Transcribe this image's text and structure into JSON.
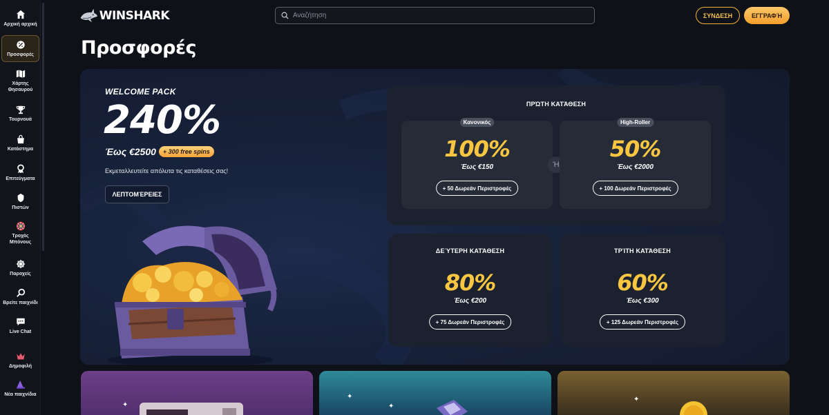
{
  "sidebar": {
    "items": [
      {
        "label": "Αρχική αρχική",
        "icon": "home-icon"
      },
      {
        "label": "Προσφορές",
        "icon": "promo-icon",
        "active": true
      },
      {
        "label": "Χάρτης Θησαυρού",
        "icon": "map-icon"
      },
      {
        "label": "Τουρνουά",
        "icon": "trophy-icon"
      },
      {
        "label": "Κατάστημα",
        "icon": "bag-icon"
      },
      {
        "label": "Επιτεύγματα",
        "icon": "achievement-icon"
      },
      {
        "label": "Πιστών",
        "icon": "loyalty-icon"
      },
      {
        "label": "Τροχός Μπόνους",
        "icon": "wheel-icon"
      },
      {
        "label": "Παροχείς",
        "icon": "providers-icon"
      },
      {
        "label": "Βρείτε παιχνίδι",
        "icon": "search-icon"
      },
      {
        "label": "Live Chat",
        "icon": "chat-icon"
      },
      {
        "label": "Δημοφιλή",
        "icon": "crown-icon"
      },
      {
        "label": "Νέα παιχνίδια",
        "icon": "wizard-hat-icon"
      }
    ]
  },
  "header": {
    "logo": "WINSHARK",
    "search_placeholder": "Αναζήτηση",
    "login_label": "ΣΥΝΔΕΣΗ",
    "register_label": "ΕΓΓΡΑΦΉ"
  },
  "page": {
    "title": "Προσφορές"
  },
  "hero": {
    "kicker": "WELCOME PACK",
    "percent": "240%",
    "upto": "Έως €2500",
    "spins_badge": "+ 300 free spins",
    "subtitle": "Εκμεταλλευτείτε απόλυτα τις καταθέσεις σας!",
    "details_label": "ΛΕΠΤΟΜΈΡΕΙΕΣ"
  },
  "offers": {
    "first": {
      "title": "ΠΡΏΤΗ ΚΑΤΆΘΕΣΗ",
      "or_label": "Ή",
      "regular": {
        "tag": "Κανονικός",
        "percent": "100%",
        "upto": "Έως €150",
        "spins": "+ 50 Δωρεάν Περιστροφές"
      },
      "highroller": {
        "tag": "High-Roller",
        "percent": "50%",
        "upto": "Έως €2000",
        "spins": "+ 100 Δωρεάν Περιστροφές"
      }
    },
    "second": {
      "title": "ΔΕΎΤΕΡΗ ΚΑΤΆΘΕΣΗ",
      "percent": "80%",
      "upto": "Έως €200",
      "spins": "+ 75 Δωρεάν Περιστροφές"
    },
    "third": {
      "title": "ΤΡΊΤΗ ΚΑΤΆΘΕΣΗ",
      "percent": "60%",
      "upto": "Έως €300",
      "spins": "+ 125 Δωρεάν Περιστροφές"
    }
  },
  "colors": {
    "accent": "#f8c640",
    "background": "#0f1118",
    "hero_bg": "#162038",
    "panel": "#1c2130",
    "card": "#262b38"
  }
}
